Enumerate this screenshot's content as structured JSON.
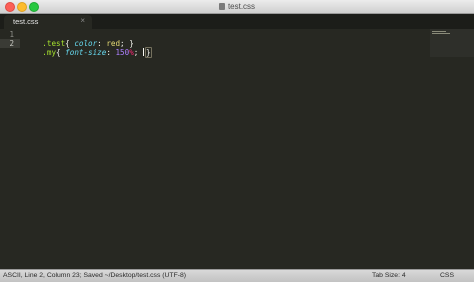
{
  "window": {
    "title": "test.css"
  },
  "tab": {
    "label": "test.css",
    "close_glyph": "×"
  },
  "gutter": {
    "line_numbers": [
      "1",
      "2"
    ]
  },
  "code": {
    "line1": {
      "selector": ".test",
      "open": "{ ",
      "property": "color",
      "colon": ": ",
      "value": "red",
      "semicolon": "; ",
      "close": "}"
    },
    "line2": {
      "selector": ".my",
      "open": "{ ",
      "property": "font-size",
      "colon": ": ",
      "number": "150",
      "unit": "%",
      "semicolon": "; ",
      "close": "}"
    }
  },
  "status": {
    "left": "ASCII, Line 2, Column 23; Saved ~/Desktop/test.css (UTF-8)",
    "tab_size": "Tab Size: 4",
    "syntax": "CSS"
  },
  "colors": {
    "editor_bg": "#272822",
    "selector": "#a6e22e",
    "property": "#66d9ef",
    "value": "#e6db74",
    "number": "#ae81ff",
    "unit": "#f92672"
  }
}
